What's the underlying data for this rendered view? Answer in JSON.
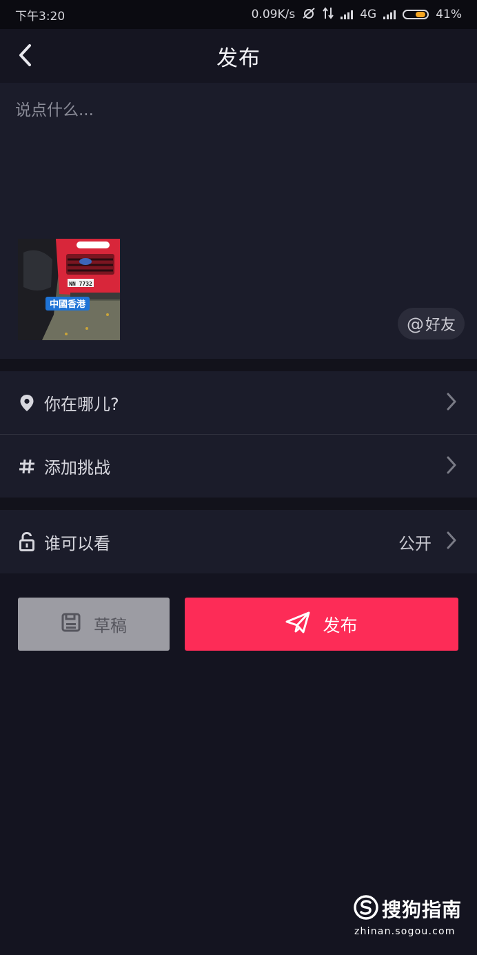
{
  "status_bar": {
    "time": "下午3:20",
    "net_speed": "0.09K/s",
    "network_type": "4G",
    "battery": "41%",
    "battery_color": "#f5a623"
  },
  "nav": {
    "back_icon": "chevron-left-icon",
    "title": "发布"
  },
  "composer": {
    "placeholder": "说点什么...",
    "value": "",
    "thumbnail_overlay": "中國香港",
    "plate_text": "NN 7732",
    "mention_at": "@",
    "mention_label": "好友"
  },
  "rows": {
    "location": {
      "icon": "location-pin-icon",
      "label": "你在哪儿?"
    },
    "challenge": {
      "icon": "hashtag-icon",
      "label": "添加挑战"
    },
    "privacy": {
      "icon": "unlock-icon",
      "label": "谁可以看",
      "value": "公开"
    }
  },
  "actions": {
    "draft": {
      "icon": "save-disk-icon",
      "label": "草稿"
    },
    "publish": {
      "icon": "paper-plane-icon",
      "label": "发布",
      "color": "#fd2c57"
    }
  },
  "watermark": {
    "brand": "搜狗指南",
    "url": "zhinan.sogou.com"
  }
}
